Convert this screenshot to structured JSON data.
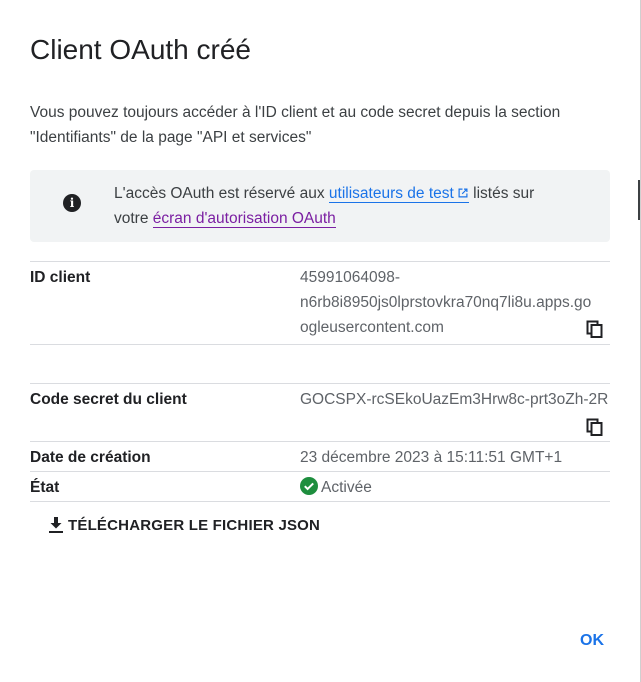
{
  "dialog": {
    "title": "Client OAuth créé",
    "intro_line1": "Vous pouvez toujours accéder à l'ID client et au code secret depuis la section",
    "intro_line2": "\"Identifiants\" de la page \"API et services\""
  },
  "notice": {
    "icon": "info-icon",
    "text_before": "L'accès OAuth est réservé aux ",
    "link_test_users": "utilisateurs de test",
    "text_middle": " listés sur",
    "text_line2_before": "votre ",
    "link_consent": "écran d'autorisation OAuth"
  },
  "fields": {
    "client_id_label": "ID client",
    "client_id_line1": "45991064098-",
    "client_id_line2": "n6rb8i8950js0lprstovkra70nq7li8u.apps.go",
    "client_id_line3": "ogleusercontent.com",
    "secret_label": "Code secret du client",
    "secret_value": "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",
    "created_label": "Date de création",
    "created_value": "23 décembre 2023 à 15:11:51 GMT+1",
    "status_label": "État",
    "status_value": "Activée"
  },
  "actions": {
    "download_label": "TÉLÉCHARGER LE FICHIER JSON",
    "ok_label": "OK"
  },
  "colors": {
    "link_blue": "#1a73e8",
    "link_visited": "#7b1fa2",
    "status_green": "#1e8e3e",
    "notice_bg": "#f1f3f4"
  }
}
